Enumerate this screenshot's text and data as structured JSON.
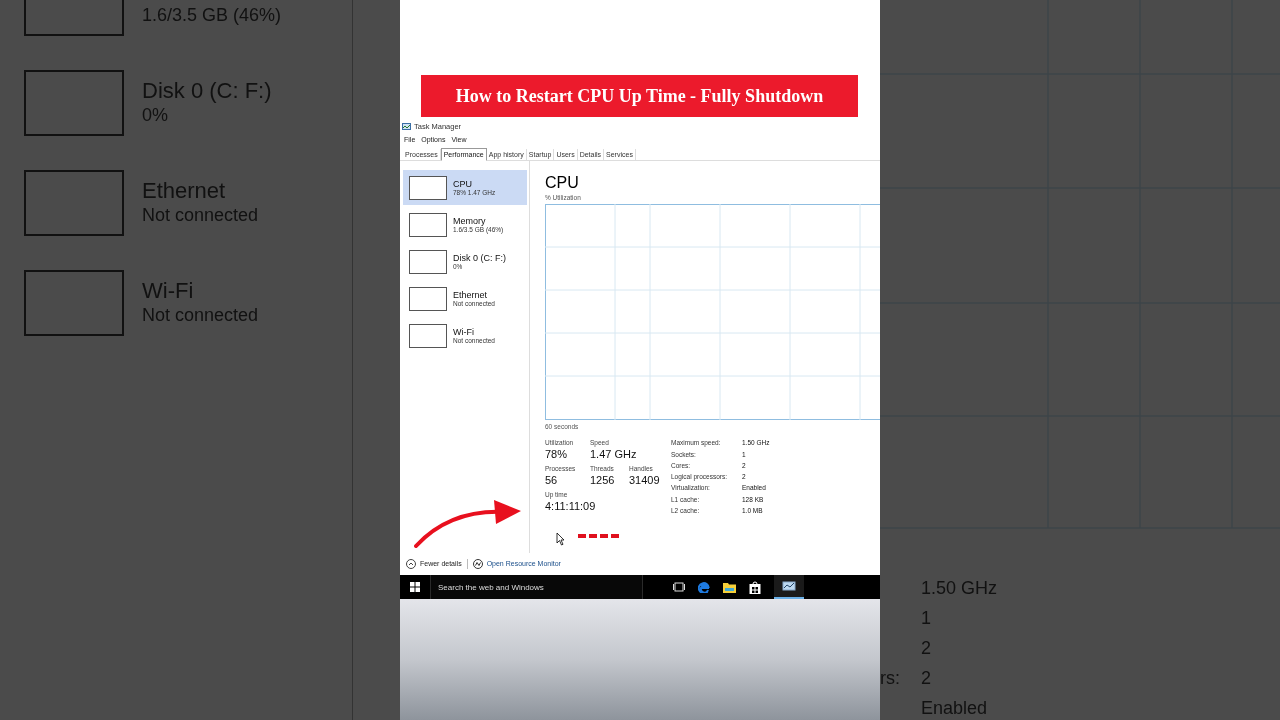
{
  "backdrop_left": {
    "items": [
      {
        "detail": "1.6/3.5 GB (46%)"
      },
      {
        "name": "Disk 0 (C: F:)",
        "detail": "0%"
      },
      {
        "name": "Ethernet",
        "detail": "Not connected"
      },
      {
        "name": "Wi-Fi",
        "detail": "Not connected"
      }
    ]
  },
  "banner": {
    "title": "How to Restart CPU Up Time - Fully Shutdown"
  },
  "window": {
    "title": "Task Manager"
  },
  "menu": [
    "File",
    "Options",
    "View"
  ],
  "tabs": [
    {
      "label": "Processes",
      "selected": false
    },
    {
      "label": "Performance",
      "selected": true
    },
    {
      "label": "App history",
      "selected": false
    },
    {
      "label": "Startup",
      "selected": false
    },
    {
      "label": "Users",
      "selected": false
    },
    {
      "label": "Details",
      "selected": false
    },
    {
      "label": "Services",
      "selected": false
    }
  ],
  "sidebar": {
    "items": [
      {
        "name": "CPU",
        "detail": "78% 1.47 GHz",
        "selected": true
      },
      {
        "name": "Memory",
        "detail": "1.6/3.5 GB (46%)",
        "selected": false
      },
      {
        "name": "Disk 0 (C: F:)",
        "detail": "0%",
        "selected": false
      },
      {
        "name": "Ethernet",
        "detail": "Not connected",
        "selected": false
      },
      {
        "name": "Wi-Fi",
        "detail": "Not connected",
        "selected": false
      }
    ]
  },
  "panel": {
    "title": "CPU",
    "graph_label": "% Utilization",
    "time_label": "60 seconds",
    "stats": [
      [
        {
          "label": "Utilization",
          "value": "78%"
        },
        {
          "label": "Speed",
          "value": "1.47 GHz"
        }
      ],
      [
        {
          "label": "Processes",
          "value": "56"
        },
        {
          "label": "Threads",
          "value": "1256"
        },
        {
          "label": "Handles",
          "value": "31409"
        }
      ],
      [
        {
          "label": "Up time",
          "value": "4:11:11:09"
        }
      ]
    ],
    "specs": [
      {
        "label": "Maximum speed:",
        "value": "1.50 GHz"
      },
      {
        "label": "Sockets:",
        "value": "1"
      },
      {
        "label": "Cores:",
        "value": "2"
      },
      {
        "label": "Logical processors:",
        "value": "2"
      },
      {
        "label": "Virtualization:",
        "value": "Enabled"
      },
      {
        "label": "L1 cache:",
        "value": "128 KB"
      },
      {
        "label": "L2 cache:",
        "value": "1.0 MB"
      }
    ]
  },
  "footer": {
    "fewer_details": "Fewer details",
    "resource_monitor": "Open Resource Monitor"
  },
  "taskbar": {
    "search_placeholder": "Search the web and Windows"
  },
  "backdrop_right": {
    "specs": [
      {
        "value": "1.50 GHz"
      },
      {
        "value": "1"
      },
      {
        "value": "2"
      },
      {
        "label": "rs:",
        "value": "2"
      },
      {
        "value": "Enabled"
      }
    ]
  }
}
